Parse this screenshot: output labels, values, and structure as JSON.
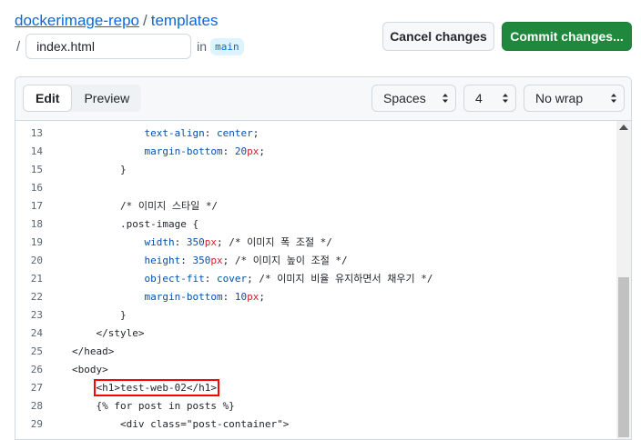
{
  "breadcrumb": {
    "repo": "dockerimage-repo",
    "separator": "/",
    "folder": "templates"
  },
  "path": {
    "slash": "/",
    "filename": "index.html",
    "in_text": "in",
    "branch": "main"
  },
  "actions": {
    "cancel": "Cancel changes",
    "commit": "Commit changes..."
  },
  "editor": {
    "tabs": {
      "edit": "Edit",
      "preview": "Preview"
    },
    "indent_mode": "Spaces",
    "indent_size": "4",
    "wrap_mode": "No wrap",
    "lines": [
      {
        "n": "13",
        "indent": "            ",
        "prop": "text-align",
        "value": "center"
      },
      {
        "n": "14",
        "indent": "            ",
        "prop": "margin-bottom",
        "num": "20",
        "unit": "px"
      },
      {
        "n": "15",
        "text": "        }"
      },
      {
        "n": "16",
        "text": ""
      },
      {
        "n": "17",
        "text": "        /* 이미지 스타일 */"
      },
      {
        "n": "18",
        "text": "        .post-image {"
      },
      {
        "n": "19",
        "indent": "            ",
        "prop": "width",
        "num": "350",
        "unit": "px",
        "comment": " /* 이미지 폭 조절 */"
      },
      {
        "n": "20",
        "indent": "            ",
        "prop": "height",
        "num": "350",
        "unit": "px",
        "comment": " /* 이미지 높이 조절 */"
      },
      {
        "n": "21",
        "indent": "            ",
        "prop": "object-fit",
        "value": "cover",
        "comment": " /* 이미지 비율 유지하면서 채우기 */"
      },
      {
        "n": "22",
        "indent": "            ",
        "prop": "margin-bottom",
        "num": "10",
        "unit": "px"
      },
      {
        "n": "23",
        "text": "        }"
      },
      {
        "n": "24",
        "text": "    </style>"
      },
      {
        "n": "25",
        "text": "</head>"
      },
      {
        "n": "26",
        "text": "<body>"
      },
      {
        "n": "27",
        "indent": "    ",
        "text_highlight": "<h1>test-web-02</h1>"
      },
      {
        "n": "28",
        "text": "    {% for post in posts %}"
      },
      {
        "n": "29",
        "text": "        <div class=\"post-container\">"
      }
    ]
  }
}
